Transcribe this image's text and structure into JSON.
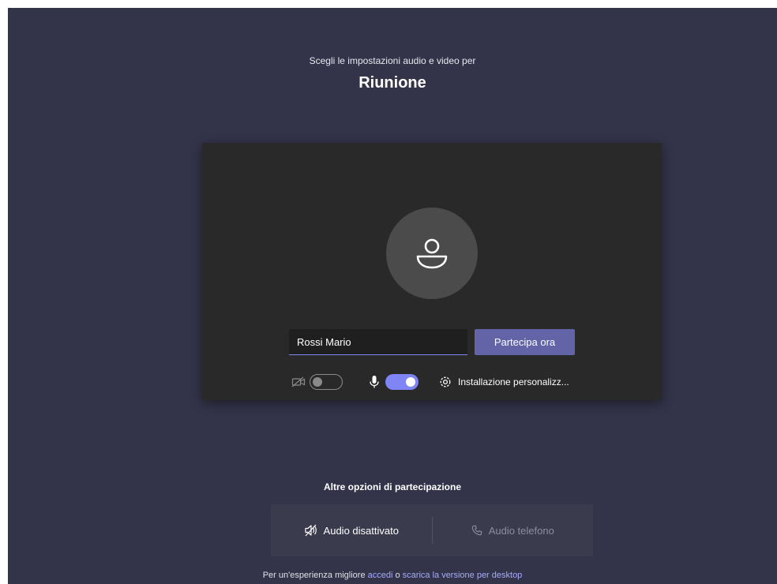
{
  "header": {
    "subtitle": "Scegli le impostazioni audio e video per",
    "meeting_title": "Riunione"
  },
  "preview": {
    "name_value": "Rossi Mario",
    "join_label": "Partecipa ora",
    "camera_on": false,
    "mic_on": true,
    "settings_label": "Installazione personalizz..."
  },
  "other_options": {
    "title": "Altre opzioni di partecipazione",
    "audio_off_label": "Audio disattivato",
    "phone_audio_label": "Audio telefono"
  },
  "footer": {
    "prefix": "Per un'esperienza migliore ",
    "signin_link": "accedi",
    "middle": " o ",
    "download_link": "scarica la versione per desktop"
  },
  "colors": {
    "background": "#33344a",
    "card": "#292929",
    "accent": "#6264a7",
    "toggle_on": "#7f85f5",
    "link": "#a6a9ff"
  }
}
